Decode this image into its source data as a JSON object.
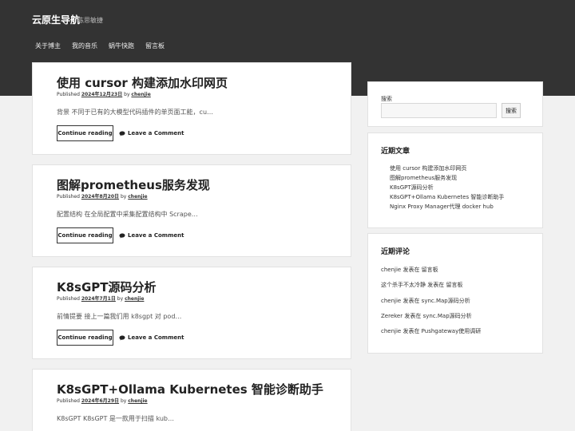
{
  "site": {
    "title": "云原生导航",
    "description": "陈思敏捷"
  },
  "nav": [
    "关于博主",
    "我的音乐",
    "蜗牛快跑",
    "留言板"
  ],
  "posts": [
    {
      "title": "使用 cursor 构建添加水印网页",
      "published_label": "Published",
      "date": "2024年12月23日",
      "by": "by",
      "author": "chenjie",
      "excerpt": "背景 不同于已有的大模型代码插件的单页面工能，cu…",
      "read_more": "Continue reading",
      "comment": "Leave a Comment"
    },
    {
      "title": "图解prometheus服务发现",
      "published_label": "Published",
      "date": "2024年8月20日",
      "by": "by",
      "author": "chenjie",
      "excerpt": "配置结构 在全局配置中采集配置结构中 Scrape…",
      "read_more": "Continue reading",
      "comment": "Leave a Comment"
    },
    {
      "title": "K8sGPT源码分析",
      "published_label": "Published",
      "date": "2024年7月1日",
      "by": "by",
      "author": "chenjie",
      "excerpt": "前情提要 接上一篇我们用 k8sgpt 对 pod…",
      "read_more": "Continue reading",
      "comment": "Leave a Comment"
    },
    {
      "title": "K8sGPT+Ollama  Kubernetes 智能诊断助手",
      "published_label": "Published",
      "date": "2024年6月29日",
      "by": "by",
      "author": "chenjie",
      "excerpt": "K8sGPT K8sGPT 是一款用于扫描 kub…"
    }
  ],
  "sidebar": {
    "search": {
      "label": "搜索",
      "placeholder": "",
      "button": "搜索"
    },
    "recent_posts": {
      "title": "近期文章",
      "items": [
        "使用 cursor 构建添加水印网页",
        "图解prometheus服务发现",
        "K8sGPT源码分析",
        "K8sGPT+Ollama  Kubernetes 智能诊断助手",
        "Nginx Proxy Manager代理 docker hub"
      ]
    },
    "recent_comments": {
      "title": "近期评论",
      "items": [
        "chenjie 发表在 留言板",
        "这个杀手不太冷静 发表在 留言板",
        "chenjie 发表在 sync.Map源码分析",
        "Zereker 发表在 sync.Map源码分析",
        "chenjie 发表在 Pushgateway使用调研"
      ]
    }
  },
  "colors": {
    "header": "#333333",
    "background": "#f1f1f1",
    "card": "#ffffff"
  }
}
